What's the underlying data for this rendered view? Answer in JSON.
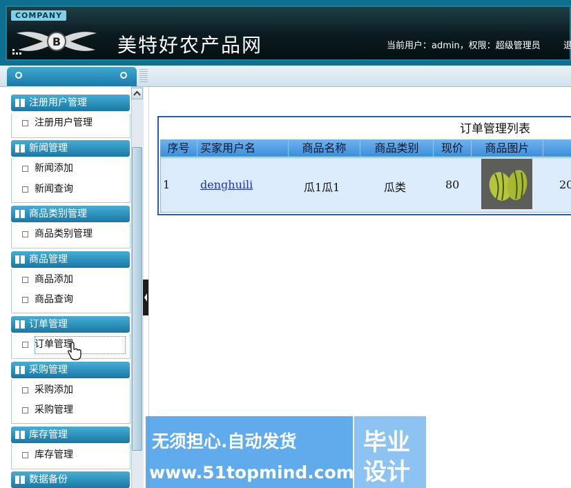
{
  "header": {
    "company_badge": "COMPANY",
    "site_title": "美特好农产品网",
    "user_info": "当前用户：admin，权限：超级管理员",
    "logout_partial": "退"
  },
  "sidebar": {
    "groups": [
      {
        "title": "注册用户管理",
        "items": [
          "注册用户管理"
        ]
      },
      {
        "title": "新闻管理",
        "items": [
          "新闻添加",
          "新闻查询"
        ]
      },
      {
        "title": "商品类别管理",
        "items": [
          "商品类别管理"
        ]
      },
      {
        "title": "商品管理",
        "items": [
          "商品添加",
          "商品查询"
        ]
      },
      {
        "title": "订单管理",
        "items": [
          "订单管理"
        ]
      },
      {
        "title": "采购管理",
        "items": [
          "采购添加",
          "采购管理"
        ]
      },
      {
        "title": "库存管理",
        "items": [
          "库存管理"
        ]
      },
      {
        "title": "数据备份",
        "items": []
      }
    ]
  },
  "table": {
    "title": "订单管理列表",
    "columns": [
      "序号",
      "买家用户名",
      "商品名称",
      "商品类别",
      "现价",
      "商品图片"
    ],
    "rows": [
      {
        "index": "1",
        "buyer": "denghuili",
        "product": "瓜1瓜1",
        "category": "瓜类",
        "price": "80",
        "partial": "20"
      }
    ]
  },
  "watermark": {
    "line1": "无须担心.自动发货",
    "line2": "www.51topmind.com",
    "right1": "毕业",
    "right2": "设计"
  },
  "colors": {
    "header_bg": "#0b1a1e",
    "sidebar_header": "#1a77a5",
    "table_header": "#3d8ed9",
    "table_border": "#2e5aa5"
  }
}
